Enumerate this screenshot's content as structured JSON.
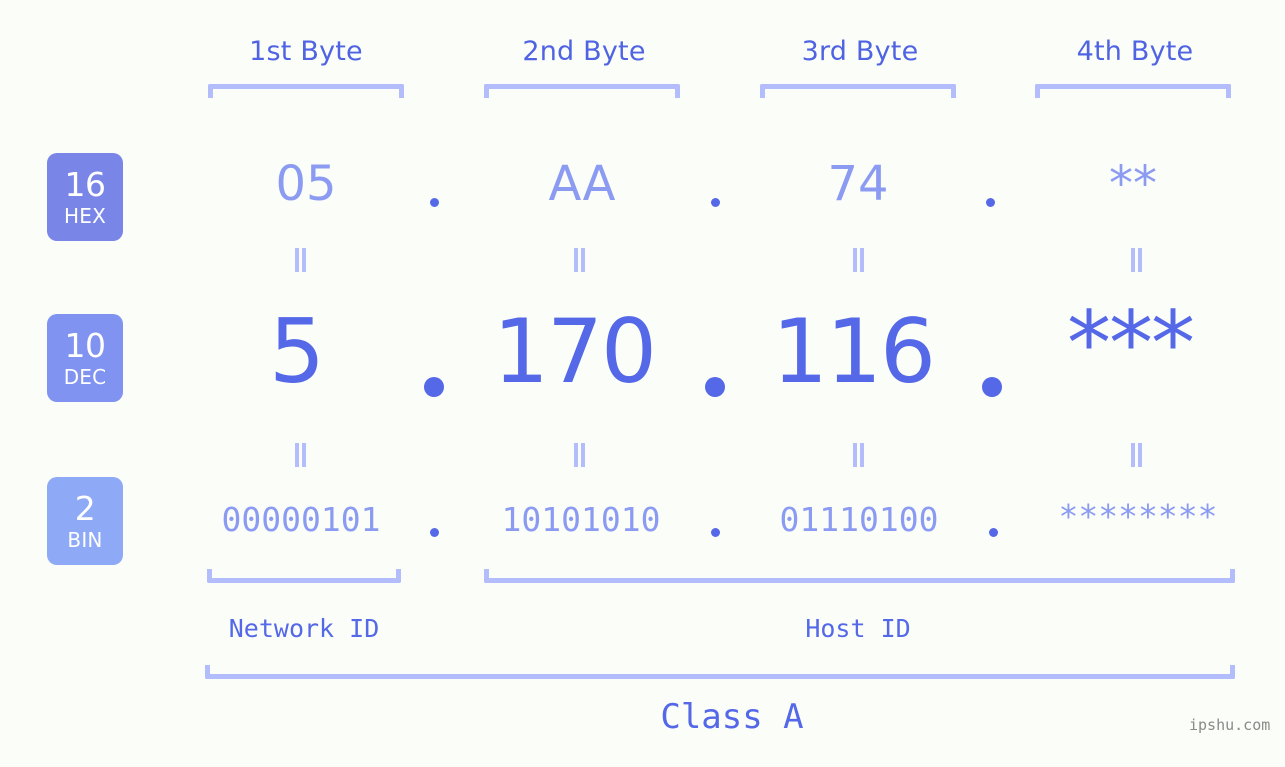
{
  "background_color": "#fbfdf8",
  "accent_colors": {
    "strong_blue": "#5468e8",
    "light_blue": "#8b9bf2",
    "bracket_blue": "#b3bdfb",
    "badge_hex": "#7986e8",
    "badge_dec": "#8093f0",
    "badge_bin": "#8ea9f5",
    "watermark_gray": "#8a8a8a"
  },
  "byte_headers": [
    {
      "label": "1st Byte"
    },
    {
      "label": "2nd Byte"
    },
    {
      "label": "3rd Byte"
    },
    {
      "label": "4th Byte"
    }
  ],
  "bases": [
    {
      "number": "16",
      "name": "HEX"
    },
    {
      "number": "10",
      "name": "DEC"
    },
    {
      "number": "2",
      "name": "BIN"
    }
  ],
  "rows": {
    "hex": {
      "octets": [
        "05",
        "AA",
        "74",
        "**"
      ],
      "separator": "."
    },
    "dec": {
      "octets": [
        "5",
        "170",
        "116",
        "***"
      ],
      "separator": "."
    },
    "bin": {
      "octets": [
        "00000101",
        "10101010",
        "01110100",
        "********"
      ],
      "separator": "."
    }
  },
  "equivalence_symbol": "||",
  "segments": {
    "network_id": "Network ID",
    "host_id": "Host ID",
    "class": "Class A"
  },
  "watermark": "ipshu.com"
}
